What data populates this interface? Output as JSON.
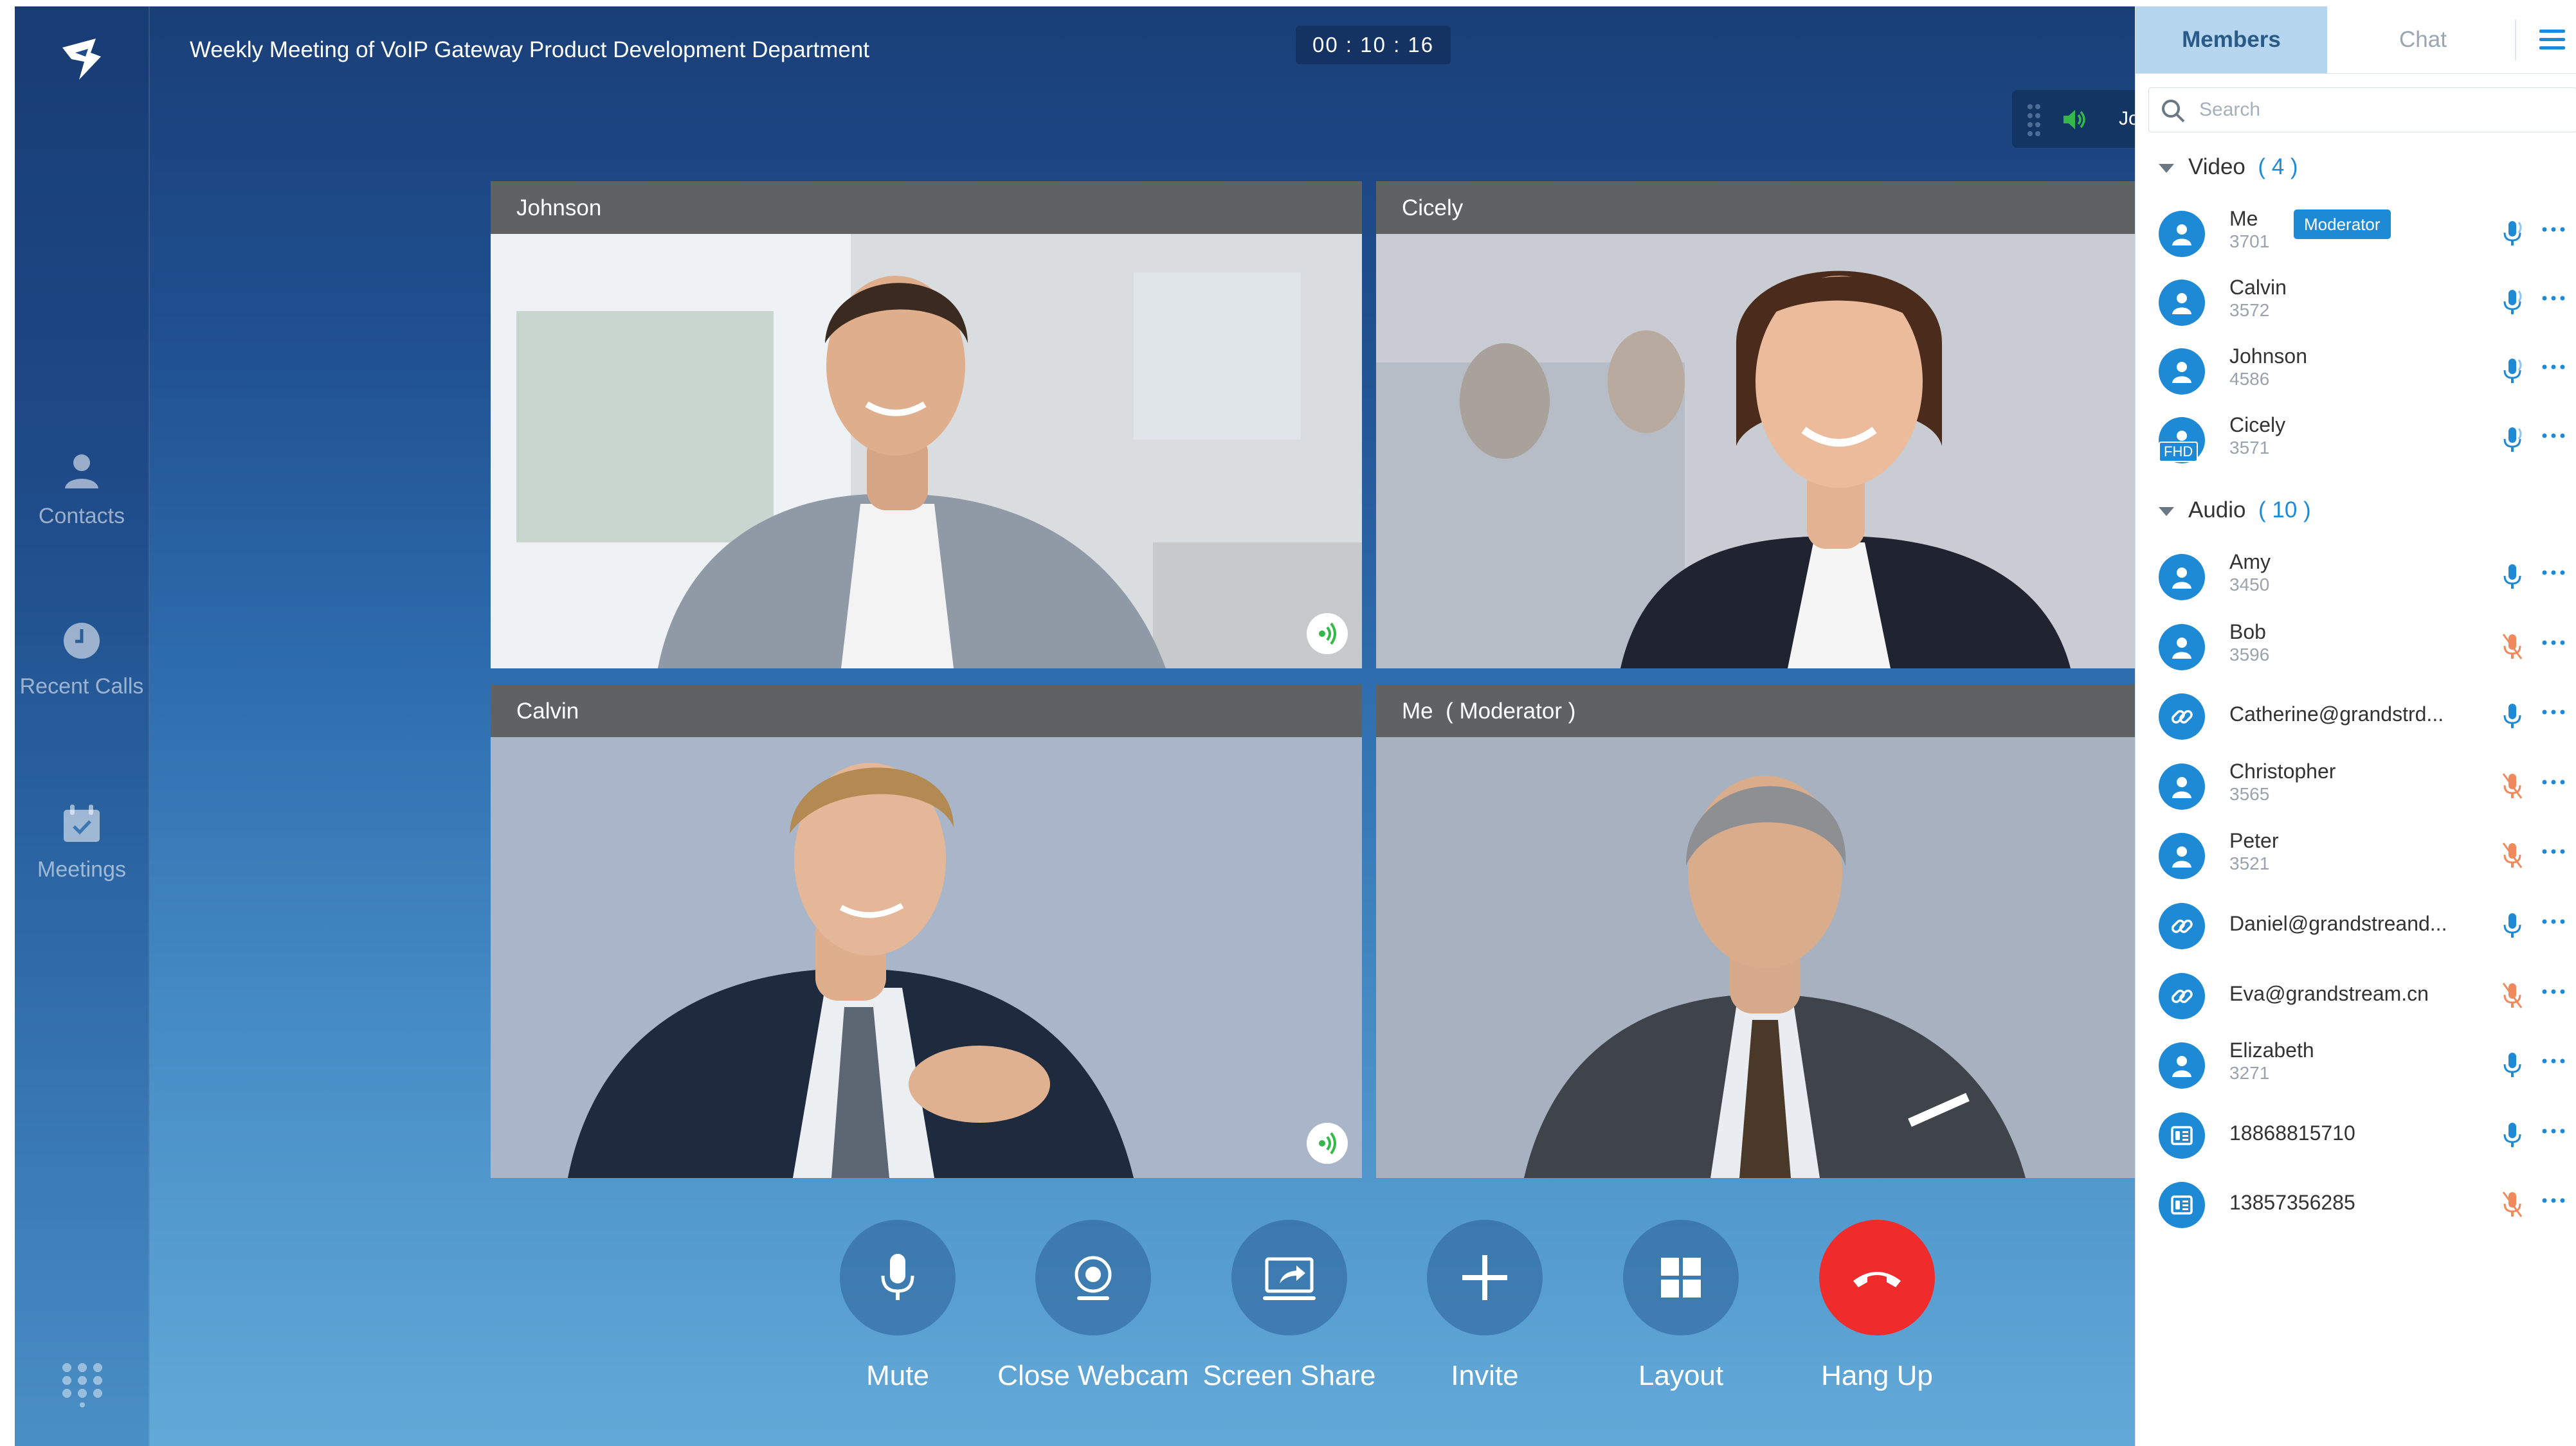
{
  "header": {
    "title": "Weekly Meeting of VoIP Gateway Product Development Department",
    "timer": "00 : 10 : 16",
    "active_speaker": "Jo"
  },
  "sidebar": {
    "items": [
      {
        "label": "Contacts",
        "icon": "person-icon"
      },
      {
        "label": "Recent Calls",
        "icon": "clock-icon"
      },
      {
        "label": "Meetings",
        "icon": "calendar-icon"
      }
    ]
  },
  "tiles": [
    {
      "name": "Johnson",
      "speaking": true
    },
    {
      "name": "Cicely",
      "speaking": false
    },
    {
      "name": "Calvin",
      "speaking": true
    },
    {
      "name": "Me",
      "role": "( Moderator )",
      "speaking": false
    }
  ],
  "controls": {
    "mute": "Mute",
    "close_webcam": "Close Webcam",
    "screen_share": "Screen Share",
    "invite": "Invite",
    "layout": "Layout",
    "hang_up": "Hang Up"
  },
  "panel": {
    "tabs": {
      "members": "Members",
      "chat": "Chat"
    },
    "search_placeholder": "Search",
    "video_group": {
      "label": "Video",
      "count": "( 4 )"
    },
    "audio_group": {
      "label": "Audio",
      "count": "( 10 )"
    },
    "video_members": [
      {
        "name": "Me",
        "ext": "3701",
        "badge": "Moderator",
        "mic": "active"
      },
      {
        "name": "Calvin",
        "ext": "3572",
        "mic": "active"
      },
      {
        "name": "Johnson",
        "ext": "4586",
        "mic": "active"
      },
      {
        "name": "Cicely",
        "ext": "3571",
        "tag": "FHD",
        "mic": "active"
      }
    ],
    "audio_members": [
      {
        "name": "Amy",
        "ext": "3450",
        "type": "user",
        "mic": "on"
      },
      {
        "name": "Bob",
        "ext": "3596",
        "type": "user",
        "mic": "muted"
      },
      {
        "name": "Catherine@grandstrd...",
        "type": "link",
        "mic": "on"
      },
      {
        "name": "Christopher",
        "ext": "3565",
        "type": "user",
        "mic": "muted"
      },
      {
        "name": "Peter",
        "ext": "3521",
        "type": "user",
        "mic": "muted"
      },
      {
        "name": "Daniel@grandstreand...",
        "type": "link",
        "mic": "on"
      },
      {
        "name": "Eva@grandstream.cn",
        "type": "link",
        "mic": "muted"
      },
      {
        "name": "Elizabeth",
        "ext": "3271",
        "type": "user",
        "mic": "on"
      },
      {
        "name": "18868815710",
        "type": "phone",
        "mic": "on"
      },
      {
        "name": "13857356285",
        "type": "phone",
        "mic": "muted"
      }
    ]
  },
  "colors": {
    "accent": "#1e8ad6",
    "hang_up": "#f02b2b",
    "muted_mic": "#f08a5d",
    "speaking": "#35b84a"
  }
}
